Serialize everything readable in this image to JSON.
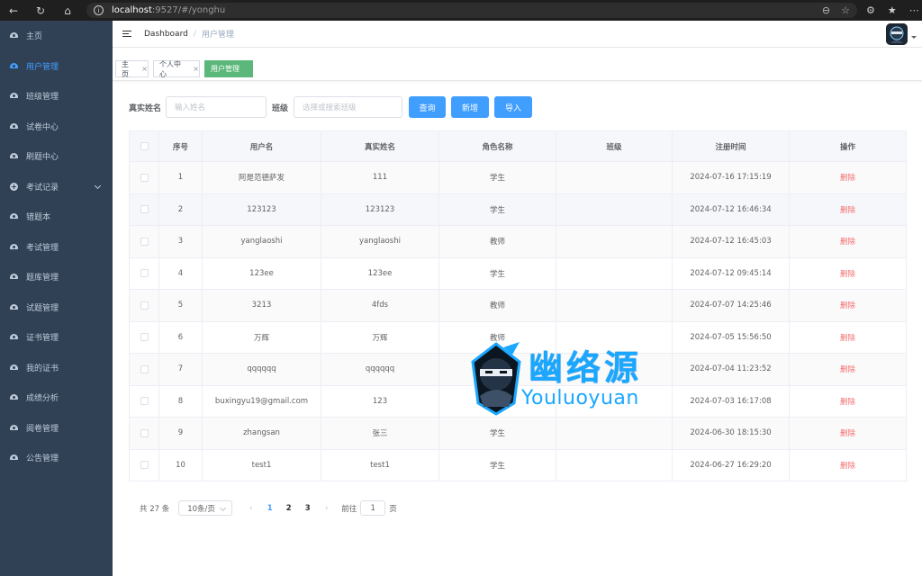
{
  "browser": {
    "url_host": "localhost",
    "url_path": ":9527/#/yonghu"
  },
  "sidebar": {
    "items": [
      {
        "label": "主页",
        "icon": "dashboard-icon",
        "active": false
      },
      {
        "label": "用户管理",
        "icon": "dashboard-icon",
        "active": true
      },
      {
        "label": "班级管理",
        "icon": "dashboard-icon",
        "active": false
      },
      {
        "label": "试卷中心",
        "icon": "dashboard-icon",
        "active": false
      },
      {
        "label": "刷题中心",
        "icon": "dashboard-icon",
        "active": false
      },
      {
        "label": "考试记录",
        "icon": "plus-circle-icon",
        "active": false,
        "submenu": true
      },
      {
        "label": "错题本",
        "icon": "dashboard-icon",
        "active": false
      },
      {
        "label": "考试管理",
        "icon": "dashboard-icon",
        "active": false
      },
      {
        "label": "题库管理",
        "icon": "dashboard-icon",
        "active": false
      },
      {
        "label": "试题管理",
        "icon": "dashboard-icon",
        "active": false
      },
      {
        "label": "证书管理",
        "icon": "dashboard-icon",
        "active": false
      },
      {
        "label": "我的证书",
        "icon": "dashboard-icon",
        "active": false
      },
      {
        "label": "成绩分析",
        "icon": "dashboard-icon",
        "active": false
      },
      {
        "label": "阅卷管理",
        "icon": "dashboard-icon",
        "active": false
      },
      {
        "label": "公告管理",
        "icon": "dashboard-icon",
        "active": false
      }
    ]
  },
  "navbar": {
    "breadcrumb_home": "Dashboard",
    "breadcrumb_sep": "/",
    "breadcrumb_current": "用户管理"
  },
  "tags": [
    {
      "label": "主页",
      "closable": true,
      "active": false
    },
    {
      "label": "个人中心",
      "closable": true,
      "active": false
    },
    {
      "label": "用户管理",
      "closable": false,
      "active": true
    }
  ],
  "search": {
    "name_label": "真实姓名",
    "name_placeholder": "输入姓名",
    "class_label": "班级",
    "class_placeholder": "选择或搜索班级",
    "query_button": "查询",
    "add_button": "新增",
    "import_button": "导入"
  },
  "table": {
    "headers": [
      "",
      "序号",
      "用户名",
      "真实姓名",
      "角色名称",
      "班级",
      "注册时间",
      "操作"
    ],
    "rows": [
      {
        "no": "1",
        "username": "阿是范德萨发",
        "realname": "111",
        "role": "学生",
        "class": "",
        "time": "2024-07-16 17:15:19",
        "action": "删除"
      },
      {
        "no": "2",
        "username": "123123",
        "realname": "123123",
        "role": "学生",
        "class": "",
        "time": "2024-07-12 16:46:34",
        "action": "删除"
      },
      {
        "no": "3",
        "username": "yanglaoshi",
        "realname": "yanglaoshi",
        "role": "教师",
        "class": "",
        "time": "2024-07-12 16:45:03",
        "action": "删除"
      },
      {
        "no": "4",
        "username": "123ee",
        "realname": "123ee",
        "role": "学生",
        "class": "",
        "time": "2024-07-12 09:45:14",
        "action": "删除"
      },
      {
        "no": "5",
        "username": "3213",
        "realname": "4fds",
        "role": "教师",
        "class": "",
        "time": "2024-07-07 14:25:46",
        "action": "删除"
      },
      {
        "no": "6",
        "username": "万辉",
        "realname": "万辉",
        "role": "教师",
        "class": "",
        "time": "2024-07-05 15:56:50",
        "action": "删除"
      },
      {
        "no": "7",
        "username": "qqqqqq",
        "realname": "qqqqqq",
        "role": "",
        "class": "",
        "time": "2024-07-04 11:23:52",
        "action": "删除"
      },
      {
        "no": "8",
        "username": "buxingyu19@gmail.com",
        "realname": "123",
        "role": "",
        "class": "",
        "time": "2024-07-03 16:17:08",
        "action": "删除"
      },
      {
        "no": "9",
        "username": "zhangsan",
        "realname": "张三",
        "role": "学生",
        "class": "",
        "time": "2024-06-30 18:15:30",
        "action": "删除"
      },
      {
        "no": "10",
        "username": "test1",
        "realname": "test1",
        "role": "学生",
        "class": "",
        "time": "2024-06-27 16:29:20",
        "action": "删除"
      }
    ]
  },
  "pagination": {
    "total": "共 27 条",
    "page_size": "10条/页",
    "pages": [
      "1",
      "2",
      "3"
    ],
    "current": "1",
    "goto_label": "前往",
    "goto_value": "1",
    "goto_suffix": "页"
  },
  "watermark": {
    "text_cn": "幽络源",
    "text_en": "Youluoyuan"
  },
  "colors": {
    "sidebar_bg": "#304156",
    "accent": "#409eff",
    "danger": "#f56c6c",
    "active_tag": "#5cb87a",
    "watermark": "#1aa7ff"
  }
}
